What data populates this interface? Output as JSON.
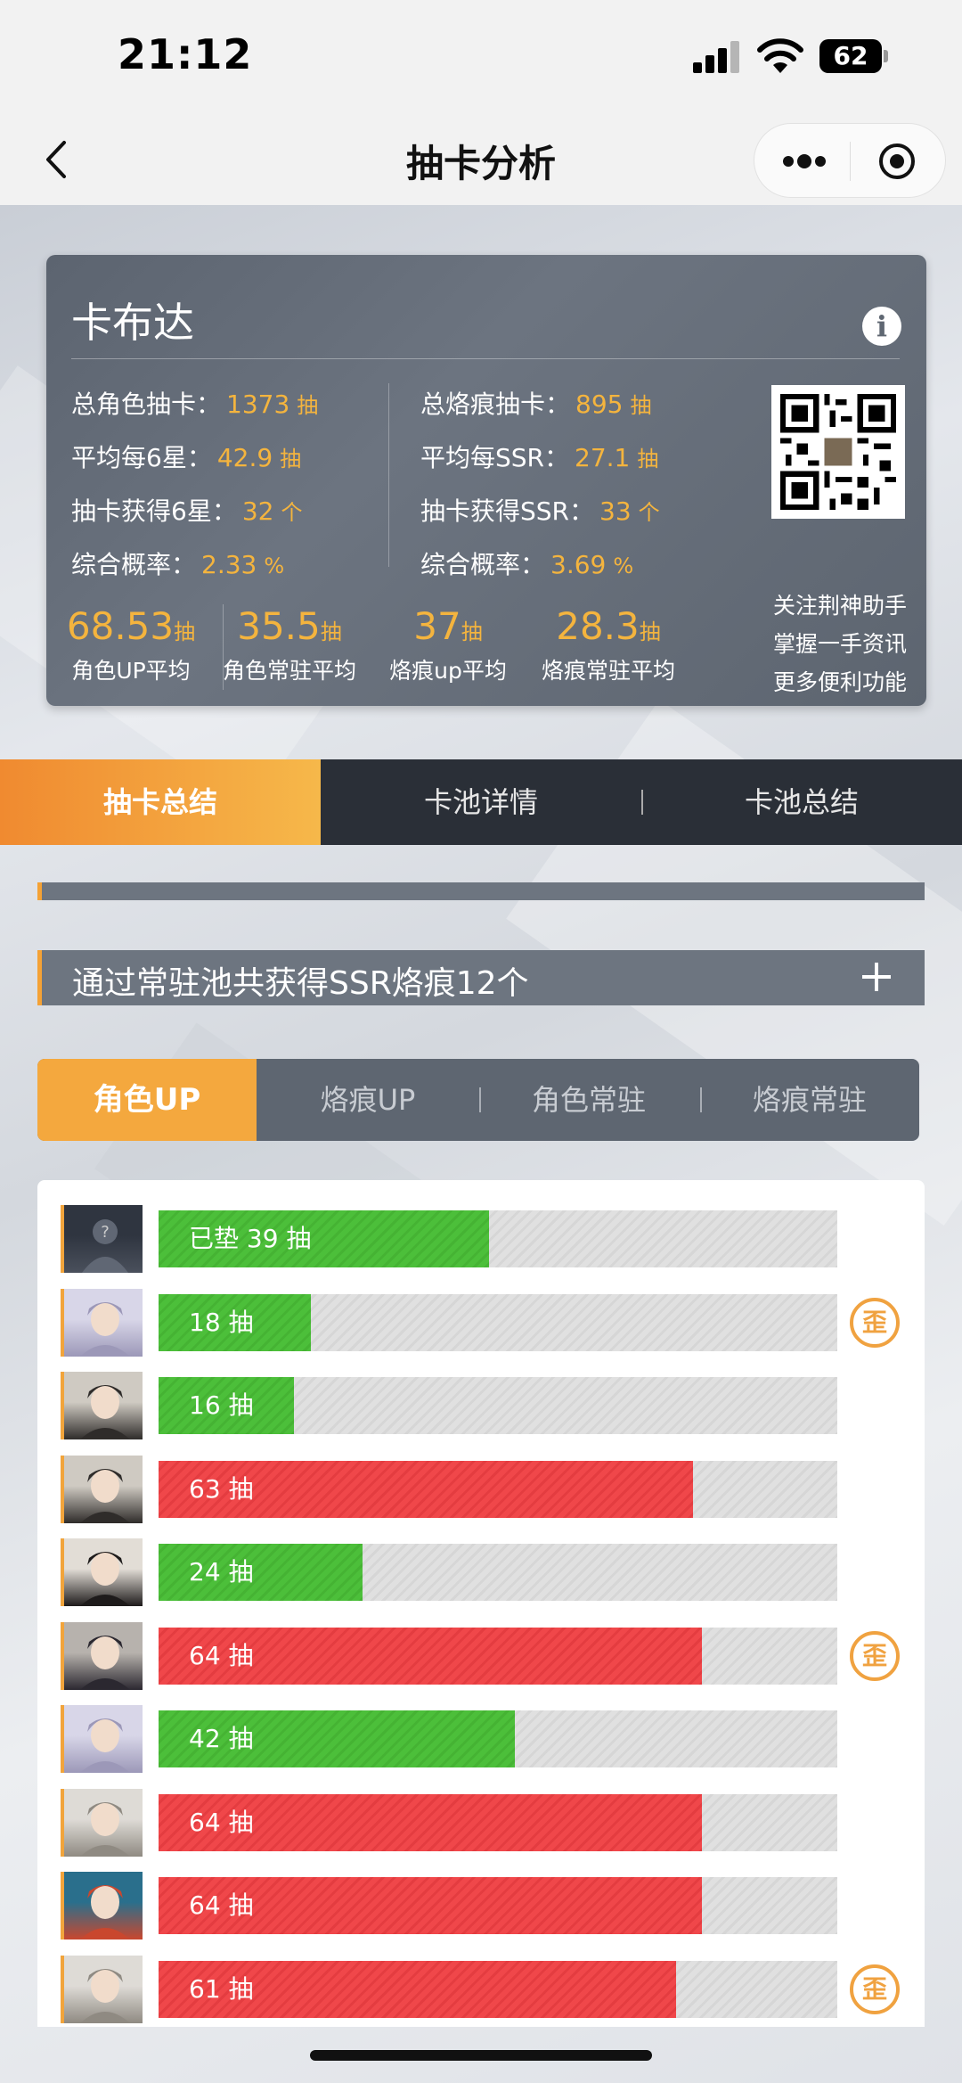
{
  "status_bar": {
    "time": "21:12",
    "battery": "62"
  },
  "nav": {
    "title": "抽卡分析"
  },
  "profile": {
    "name": "卡布达",
    "info_icon": "i",
    "left_stats": [
      {
        "label": "总角色抽卡：",
        "value": "1373",
        "unit": "抽"
      },
      {
        "label": "平均每6星：",
        "value": "42.9",
        "unit": "抽"
      },
      {
        "label": "抽卡获得6星：",
        "value": "32",
        "unit": "个"
      },
      {
        "label": "综合概率：",
        "value": "2.33",
        "unit": "%"
      }
    ],
    "right_stats": [
      {
        "label": "总烙痕抽卡：",
        "value": "895",
        "unit": "抽"
      },
      {
        "label": "平均每SSR：",
        "value": "27.1",
        "unit": "抽"
      },
      {
        "label": "抽卡获得SSR：",
        "value": "33",
        "unit": "个"
      },
      {
        "label": "综合概率：",
        "value": "3.69",
        "unit": "%"
      }
    ],
    "averages": [
      {
        "value": "68.53",
        "unit": "抽",
        "label": "角色UP平均"
      },
      {
        "value": "35.5",
        "unit": "抽",
        "label": "角色常驻平均"
      },
      {
        "value": "37",
        "unit": "抽",
        "label": "烙痕up平均"
      },
      {
        "value": "28.3",
        "unit": "抽",
        "label": "烙痕常驻平均"
      }
    ],
    "follow_lines": [
      "关注荆神助手",
      "掌握一手资讯",
      "更多便利功能"
    ]
  },
  "main_tabs": [
    {
      "label": "抽卡总结",
      "active": true
    },
    {
      "label": "卡池详情",
      "active": false
    },
    {
      "label": "卡池总结",
      "active": false
    }
  ],
  "summary_bars": [
    {
      "text": ""
    },
    {
      "text": "通过常驻池共获得SSR烙痕12个"
    }
  ],
  "sub_tabs": [
    {
      "label": "角色UP",
      "active": true
    },
    {
      "label": "烙痕UP",
      "active": false
    },
    {
      "label": "角色常驻",
      "active": false
    },
    {
      "label": "烙痕常驻",
      "active": false
    }
  ],
  "pull_max": 80,
  "wai_label": "歪",
  "pulls": [
    {
      "label": "已垫 39 抽",
      "count": 39,
      "color": "green",
      "wai": false,
      "avatar": "unknown-avatar"
    },
    {
      "label": "18 抽",
      "count": 18,
      "color": "green",
      "wai": true,
      "avatar": "silver-hair-avatar"
    },
    {
      "label": "16 抽",
      "count": 16,
      "color": "green",
      "wai": false,
      "avatar": "dark-hair-avatar"
    },
    {
      "label": "63 抽",
      "count": 63,
      "color": "red",
      "wai": false,
      "avatar": "dark-hair-avatar"
    },
    {
      "label": "24 抽",
      "count": 24,
      "color": "green",
      "wai": false,
      "avatar": "red-accent-avatar"
    },
    {
      "label": "64 抽",
      "count": 64,
      "color": "red",
      "wai": true,
      "avatar": "dark-armor-avatar"
    },
    {
      "label": "42 抽",
      "count": 42,
      "color": "green",
      "wai": false,
      "avatar": "silver-hair-avatar"
    },
    {
      "label": "64 抽",
      "count": 64,
      "color": "red",
      "wai": false,
      "avatar": "white-hair-avatar"
    },
    {
      "label": "64 抽",
      "count": 64,
      "color": "red",
      "wai": false,
      "avatar": "colorful-avatar"
    },
    {
      "label": "61 抽",
      "count": 61,
      "color": "red",
      "wai": true,
      "avatar": "white-hair-avatar"
    }
  ],
  "colors": {
    "accent": "#f4a83e",
    "gold_text": "#f4b43e",
    "bar_green": "#4cbf3a",
    "bar_red": "#f0474a",
    "card_bg": "#646c77"
  }
}
